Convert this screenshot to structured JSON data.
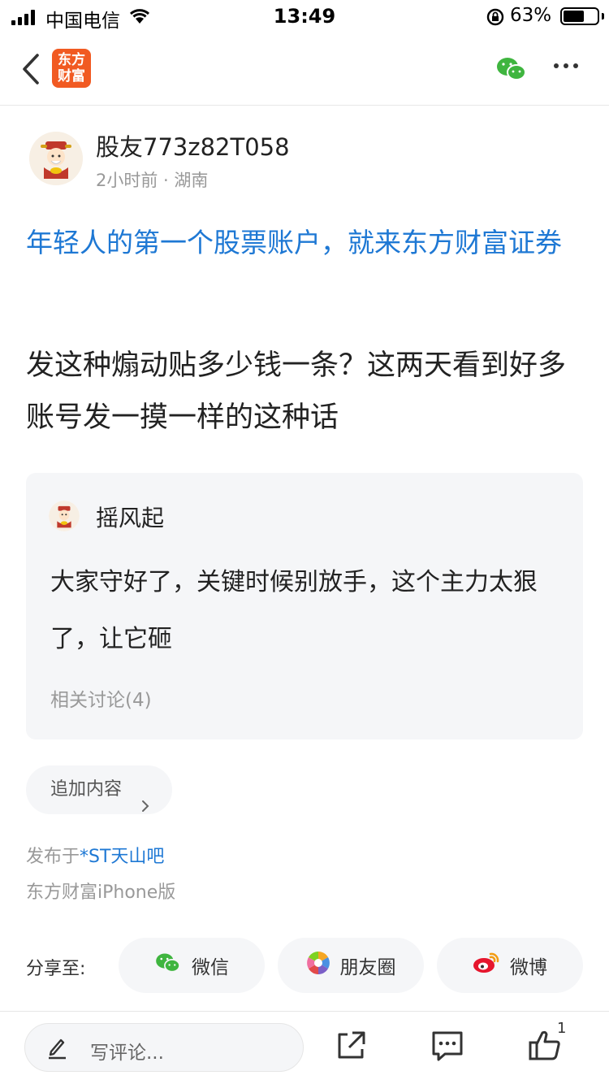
{
  "status_bar": {
    "carrier": "中国电信",
    "time": "13:49",
    "battery_percent": "63%",
    "battery_level": 0.63
  },
  "nav": {
    "logo_line1": "东方",
    "logo_line2": "财富"
  },
  "author": {
    "name": "股友773z82T058",
    "meta": "2小时前 · 湖南"
  },
  "ad_link": "年轻人的第一个股票账户，就来东方财富证券",
  "post_body": "发这种煽动贴多少钱一条？这两天看到好多账号发一摸一样的这种话",
  "quote": {
    "name": "摇风起",
    "text": "大家守好了，关键时候别放手，这个主力太狠了，让它砸",
    "related": "相关讨论(4)"
  },
  "add_content": "追加内容",
  "posted_prefix": "发布于",
  "posted_bar": "*ST天山吧",
  "client": "东方财富iPhone版",
  "share": {
    "label": "分享至:",
    "wechat": "微信",
    "moments": "朋友圈",
    "weibo": "微博"
  },
  "bottom": {
    "comment_placeholder": "写评论...",
    "like_count": "1"
  },
  "colors": {
    "link_blue": "#1e78d4",
    "brand_orange": "#f15a22",
    "wechat_green": "#3fb53f",
    "weibo_red": "#e6162d"
  }
}
